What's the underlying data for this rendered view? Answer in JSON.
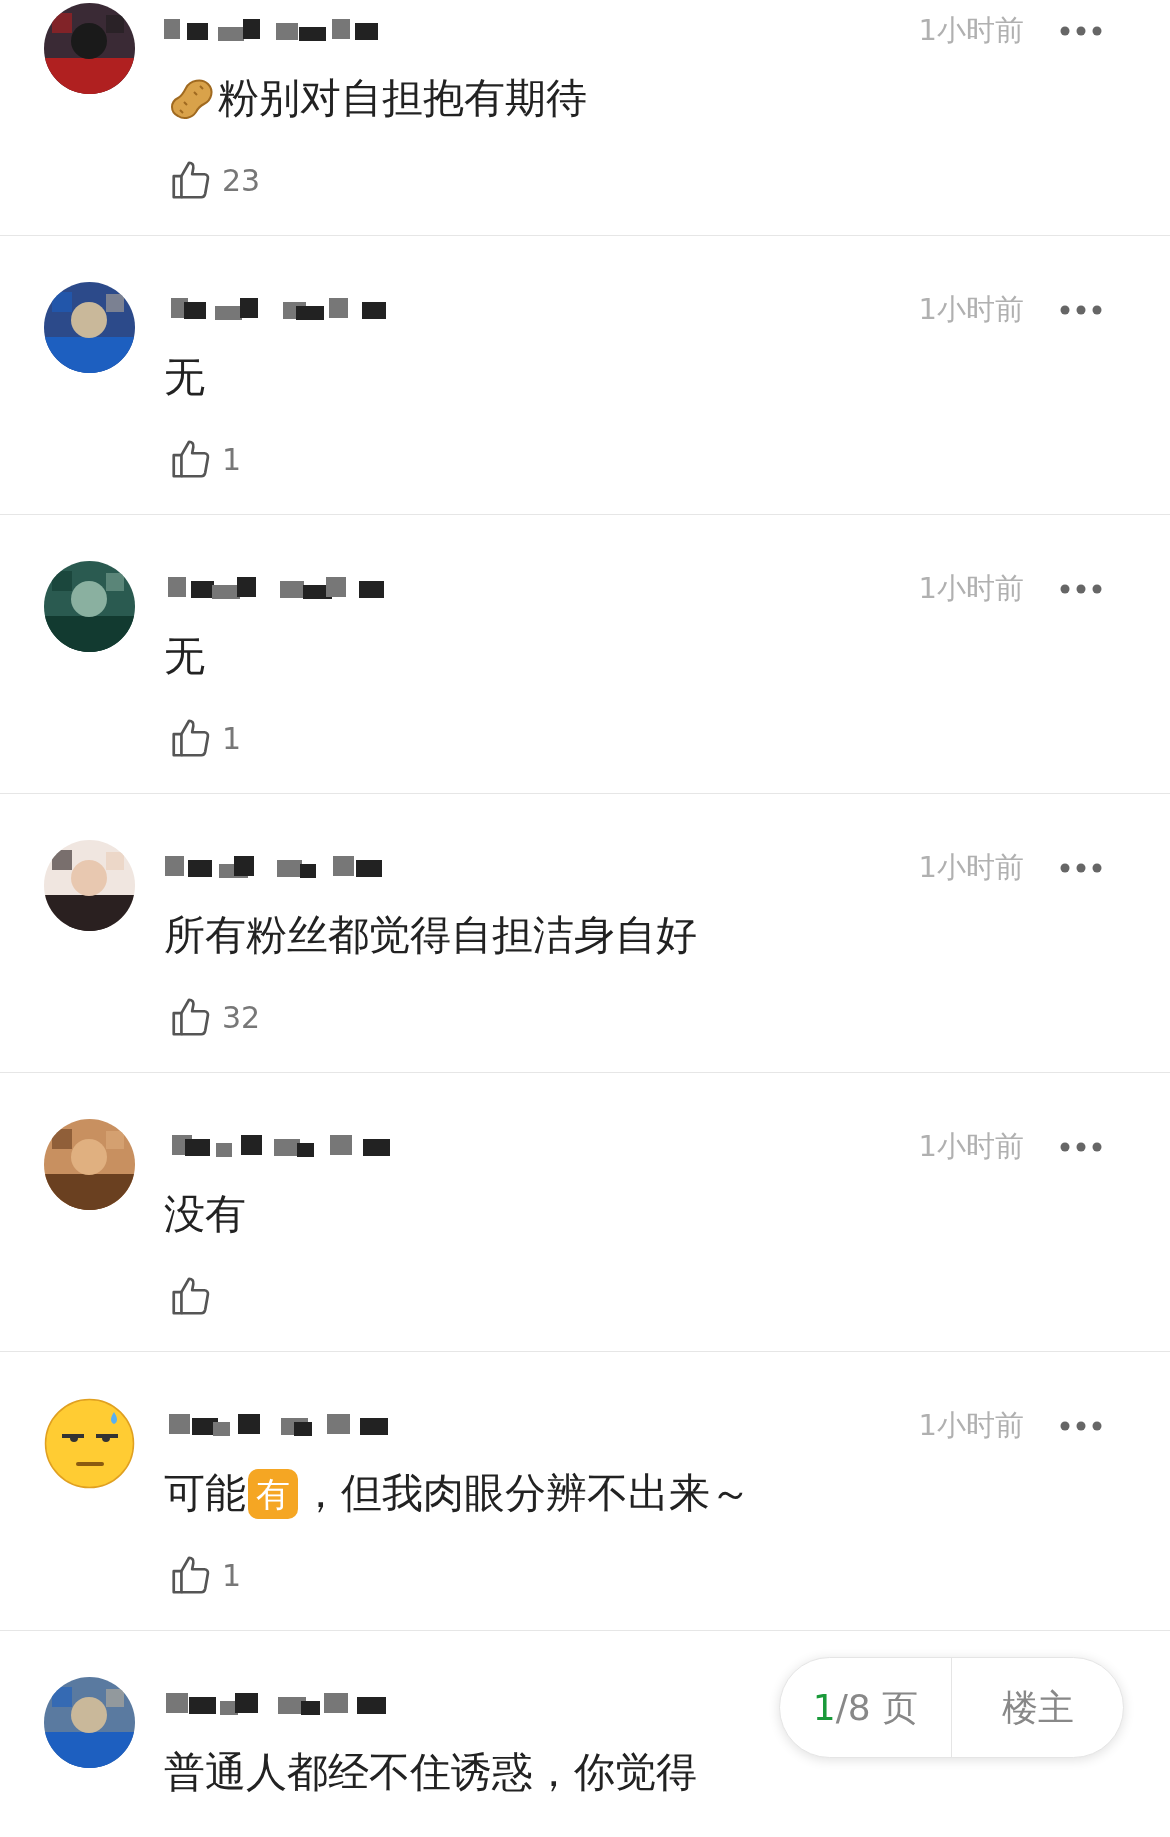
{
  "comments": [
    {
      "avatar": {
        "kind": "picture"
      },
      "time": "1小时前",
      "segments": [
        {
          "kind": "peanut"
        },
        {
          "kind": "text",
          "text": "粉别对自担抱有期待"
        }
      ],
      "likes": "23"
    },
    {
      "avatar": {
        "kind": "picture"
      },
      "time": "1小时前",
      "segments": [
        {
          "kind": "text",
          "text": "无"
        }
      ],
      "likes": "1"
    },
    {
      "avatar": {
        "kind": "picture"
      },
      "time": "1小时前",
      "segments": [
        {
          "kind": "text",
          "text": "无"
        }
      ],
      "likes": "1"
    },
    {
      "avatar": {
        "kind": "picture"
      },
      "time": "1小时前",
      "segments": [
        {
          "kind": "text",
          "text": "所有粉丝都觉得自担洁身自好"
        }
      ],
      "likes": "32"
    },
    {
      "avatar": {
        "kind": "picture"
      },
      "time": "1小时前",
      "segments": [
        {
          "kind": "text",
          "text": "没有"
        }
      ]
    },
    {
      "avatar": {
        "kind": "emoji"
      },
      "time": "1小时前",
      "segments": [
        {
          "kind": "text",
          "text": "可能"
        },
        {
          "kind": "badge",
          "text": "有"
        },
        {
          "kind": "text",
          "text": "，但我肉眼分辨不出来～"
        }
      ],
      "likes": "1"
    },
    {
      "avatar": {
        "kind": "picture"
      },
      "segments": [
        {
          "kind": "text",
          "text": "普通人都经不住诱惑，你觉得"
        }
      ]
    }
  ],
  "pager": {
    "current": "1",
    "total": "/8 页",
    "owner": "楼主"
  }
}
